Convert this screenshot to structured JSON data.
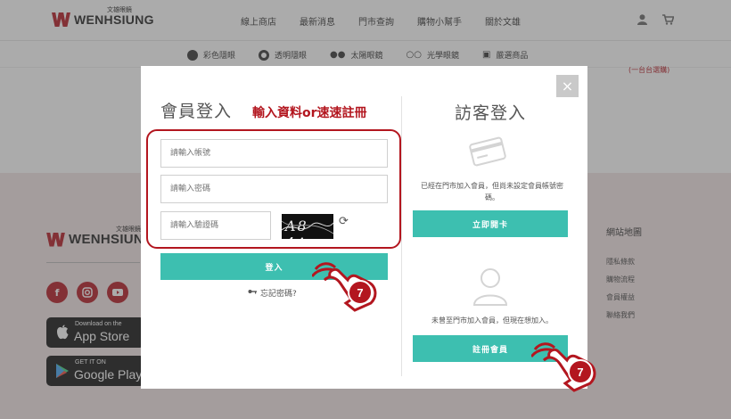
{
  "header": {
    "brand": "WENHSIUNG",
    "brand_cn": "文雄眼鏡",
    "nav": [
      "線上商店",
      "最新消息",
      "門市查詢",
      "購物小幫手",
      "關於文雄"
    ],
    "user_icon": "user-icon",
    "cart_icon": "cart-icon"
  },
  "categories": [
    "彩色隱眼",
    "透明隱眼",
    "太陽眼鏡",
    "光學眼鏡",
    "嚴選商品"
  ],
  "background_note": "(一台台選購)",
  "footer": {
    "brand": "WENHSIUNG",
    "brand_cn": "文雄眼鏡",
    "social": [
      "f",
      "ig",
      "yt"
    ],
    "app_store": {
      "small": "Download on the",
      "big": "App Store"
    },
    "google_play": {
      "small": "GET IT ON",
      "big": "Google Play"
    },
    "sitemap_title": "網站地圖",
    "sitemap_links": [
      "隱私條款",
      "購物流程",
      "會員權益",
      "聯絡我們"
    ]
  },
  "modal": {
    "close_label": "×",
    "member": {
      "title": "會員登入",
      "hint": "輸入資料or速速註冊",
      "account_placeholder": "請輸入帳號",
      "password_placeholder": "請輸入密碼",
      "captcha_placeholder": "請輸入驗證碼",
      "captcha_text": "A8 4A",
      "login_label": "登入",
      "forgot_label": "忘記密碼?"
    },
    "guest": {
      "title": "訪客登入",
      "desc_open_card": "已經在門市加入會員，但尚未設定會員帳號密碼。",
      "open_card_label": "立即開卡",
      "desc_register": "未曾至門市加入會員，但現在想加入。",
      "register_label": "註冊會員"
    }
  },
  "callouts": {
    "step": "7"
  },
  "colors": {
    "brand_red": "#b3161f",
    "teal": "#3dbfb0"
  }
}
